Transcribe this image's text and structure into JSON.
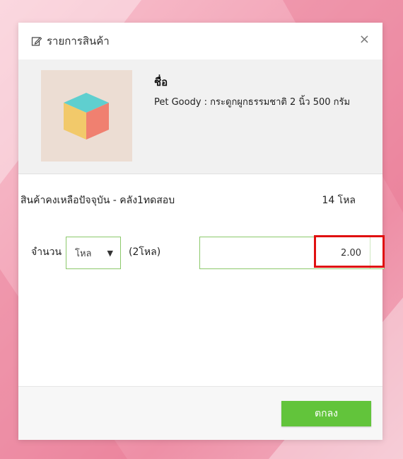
{
  "modal": {
    "title": "รายการสินค้า",
    "close_label": "×"
  },
  "product": {
    "name_label": "ชื่อ",
    "name": "Pet Goody : กระดูกผูกธรรมชาติ 2 นิ้ว 500 กรัม",
    "thumbnail_icon": "cube-icon"
  },
  "stock": {
    "label": "สินค้าคงเหลือปัจจุบัน -  คลัง1ทดสอบ",
    "value": "14 โหล"
  },
  "quantity": {
    "label": "จำนวน",
    "unit_selected": "โหล",
    "unit_hint": "(2โหล)",
    "value": "2.00"
  },
  "footer": {
    "ok_label": "ตกลง"
  },
  "colors": {
    "accent_green": "#62c43b",
    "input_border": "#8cc96b",
    "highlight": "#e01010"
  }
}
